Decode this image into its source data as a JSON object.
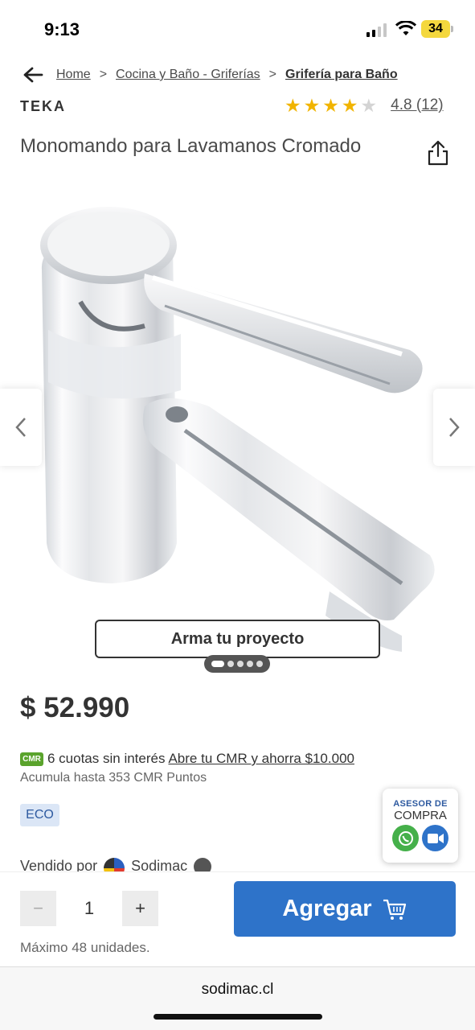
{
  "status_bar": {
    "time": "9:13",
    "battery": "34"
  },
  "breadcrumb": {
    "items": [
      "Home",
      "Cocina y Baño - Griferías",
      "Grifería para Baño"
    ],
    "separator": ">"
  },
  "product": {
    "brand": "TEKA",
    "rating_value": 4,
    "rating_max": 5,
    "rating_text": "4.8 (12)",
    "title": "Monomando para Lavamanos Cromado",
    "project_button": "Arma tu proyecto",
    "gallery_count": 5,
    "gallery_active": 0,
    "price": "$ 52.990",
    "cmr_badge": "CMR",
    "installments": "6 cuotas sin interés",
    "cmr_link": "Abre tu CMR y ahorra $10.000",
    "points": "Acumula hasta 353 CMR Puntos",
    "eco_badge": "ECO",
    "seller_label": "Vendido por",
    "seller_name": "Sodimac"
  },
  "advisor": {
    "line1": "ASESOR DE",
    "line2": "COMPRA"
  },
  "purchase": {
    "quantity": "1",
    "minus": "−",
    "plus": "+",
    "max_units": "Máximo 48 unidades.",
    "add_label": "Agregar"
  },
  "browser": {
    "url": "sodimac.cl"
  },
  "colors": {
    "accent": "#2e73c9",
    "star": "#f1b400",
    "cmr_green": "#5aa32c",
    "eco_bg": "#dbe6f6"
  }
}
